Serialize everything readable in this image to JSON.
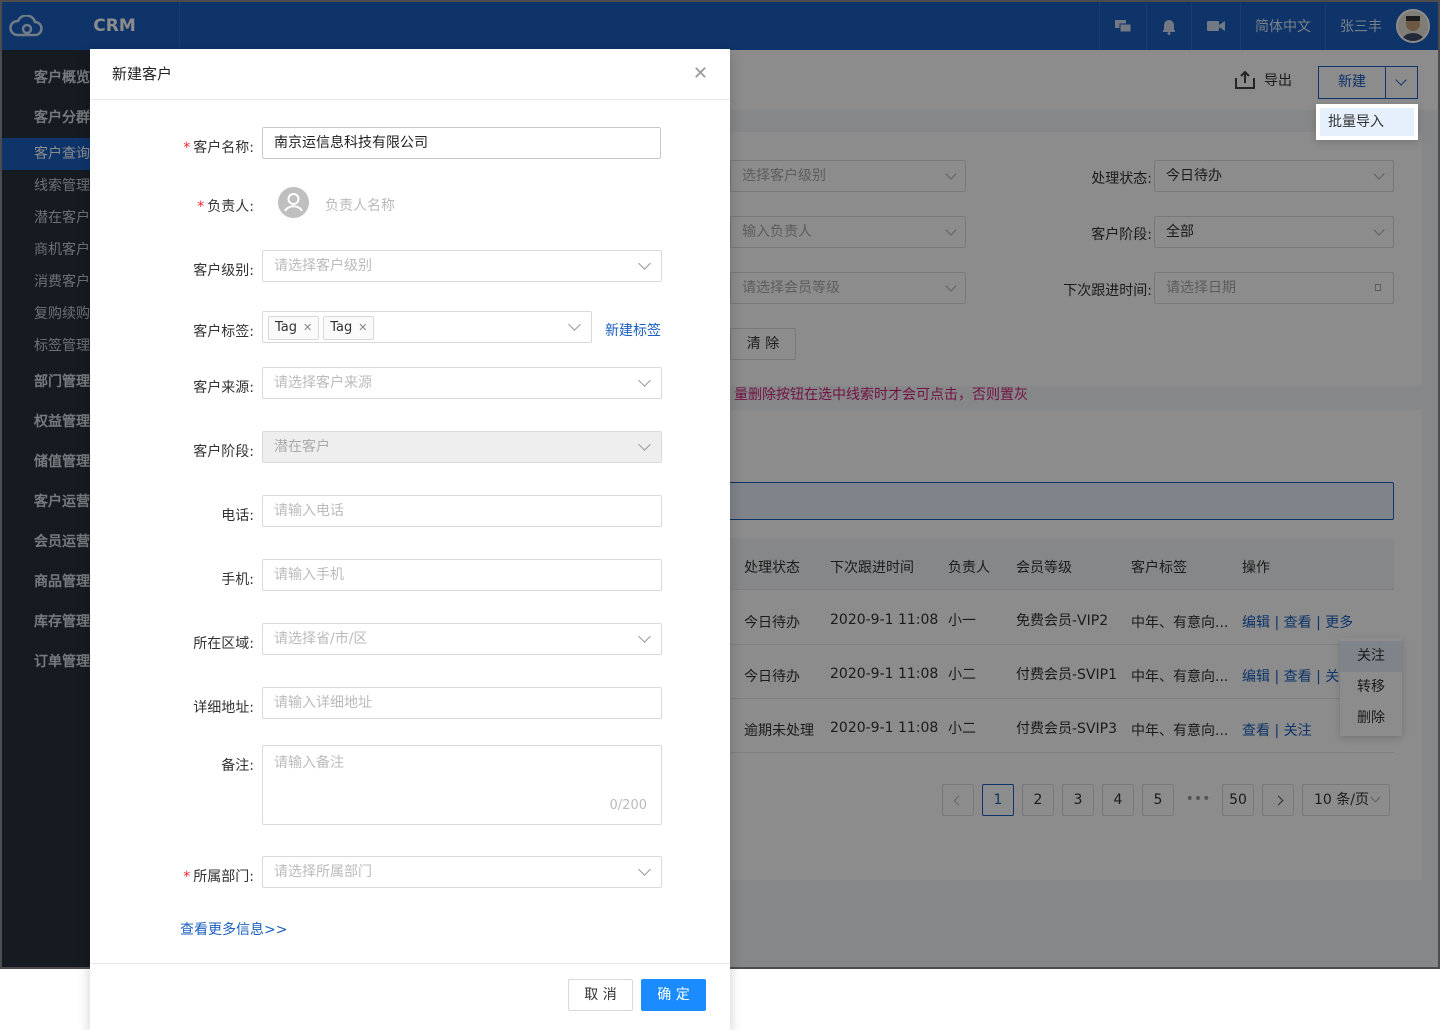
{
  "app": {
    "brand": "CRM",
    "lang": "简体中文",
    "user": "张三丰",
    "icons": [
      "chat-icon",
      "bell-icon",
      "video-icon"
    ]
  },
  "sidebar": {
    "items": [
      {
        "label": "客户概览",
        "group": true
      },
      {
        "label": "客户分群",
        "group": true
      },
      {
        "label": "客户查询",
        "active": true
      },
      {
        "label": "线索管理"
      },
      {
        "label": "潜在客户"
      },
      {
        "label": "商机客户"
      },
      {
        "label": "消费客户"
      },
      {
        "label": "复购续购"
      },
      {
        "label": "标签管理"
      },
      {
        "label": "部门管理",
        "group": true
      },
      {
        "label": "权益管理",
        "group": true
      },
      {
        "label": "储值管理",
        "group": true
      },
      {
        "label": "客户运营",
        "group": true
      },
      {
        "label": "会员运营",
        "group": true
      },
      {
        "label": "商品管理",
        "group": true
      },
      {
        "label": "库存管理",
        "group": true
      },
      {
        "label": "订单管理",
        "group": true
      }
    ]
  },
  "header": {
    "export": "导出",
    "new": "新建",
    "batch_import": "批量导入"
  },
  "filters": {
    "level_ph": "选择客户级别",
    "owner_ph": "输入负责人",
    "member_ph": "请选择会员等级",
    "status_label": "处理状态:",
    "status_val": "今日待办",
    "stage_label": "客户阶段:",
    "stage_val": "全部",
    "next_label": "下次跟进时间:",
    "next_ph": "请选择日期",
    "clear": "清 除"
  },
  "notice": "量删除按钮在选中线索时才会可点击，否则置灰",
  "table": {
    "headers": [
      "处理状态",
      "下次跟进时间",
      "负责人",
      "会员等级",
      "客户标签",
      "操作"
    ],
    "rows": [
      {
        "status": "今日待办",
        "time": "2020-9-1 11:08",
        "owner": "小一",
        "level": "免费会员-VIP2",
        "tags": "中年、有意向...",
        "ops": "编辑 | 查看 | 更多"
      },
      {
        "status": "今日待办",
        "time": "2020-9-1 11:08",
        "owner": "小二",
        "level": "付费会员-SVIP1",
        "tags": "中年、有意向...",
        "ops": "编辑 | 查看 | 关注"
      },
      {
        "status": "逾期未处理",
        "time": "2020-9-1 11:08",
        "owner": "小二",
        "level": "付费会员-SVIP3",
        "tags": "中年、有意向...",
        "ops": "查看 | 关注"
      }
    ],
    "more_menu": [
      "关注",
      "转移",
      "删除"
    ]
  },
  "pagination": {
    "pages": [
      "1",
      "2",
      "3",
      "4",
      "5",
      "•••",
      "50"
    ],
    "size": "10 条/页"
  },
  "modal": {
    "title": "新建客户",
    "name_label": "客户名称:",
    "name_val": "南京运信息科技有限公司",
    "owner_label": "负责人:",
    "owner_ph": "负责人名称",
    "level_label": "客户级别:",
    "level_ph": "请选择客户级别",
    "tag_label": "客户标签:",
    "tags": [
      "Tag",
      "Tag"
    ],
    "new_tag": "新建标签",
    "source_label": "客户来源:",
    "source_ph": "请选择客户来源",
    "stage_label": "客户阶段:",
    "stage_val": "潜在客户",
    "phone_label": "电话:",
    "phone_ph": "请输入电话",
    "mobile_label": "手机:",
    "mobile_ph": "请输入手机",
    "region_label": "所在区域:",
    "region_ph": "请选择省/市/区",
    "address_label": "详细地址:",
    "address_ph": "请输入详细地址",
    "remark_label": "备注:",
    "remark_ph": "请输入备注",
    "remark_count": "0/200",
    "dept_label": "所属部门:",
    "dept_ph": "请选择所属部门",
    "more": "查看更多信息>>",
    "cancel": "取 消",
    "ok": "确 定"
  }
}
